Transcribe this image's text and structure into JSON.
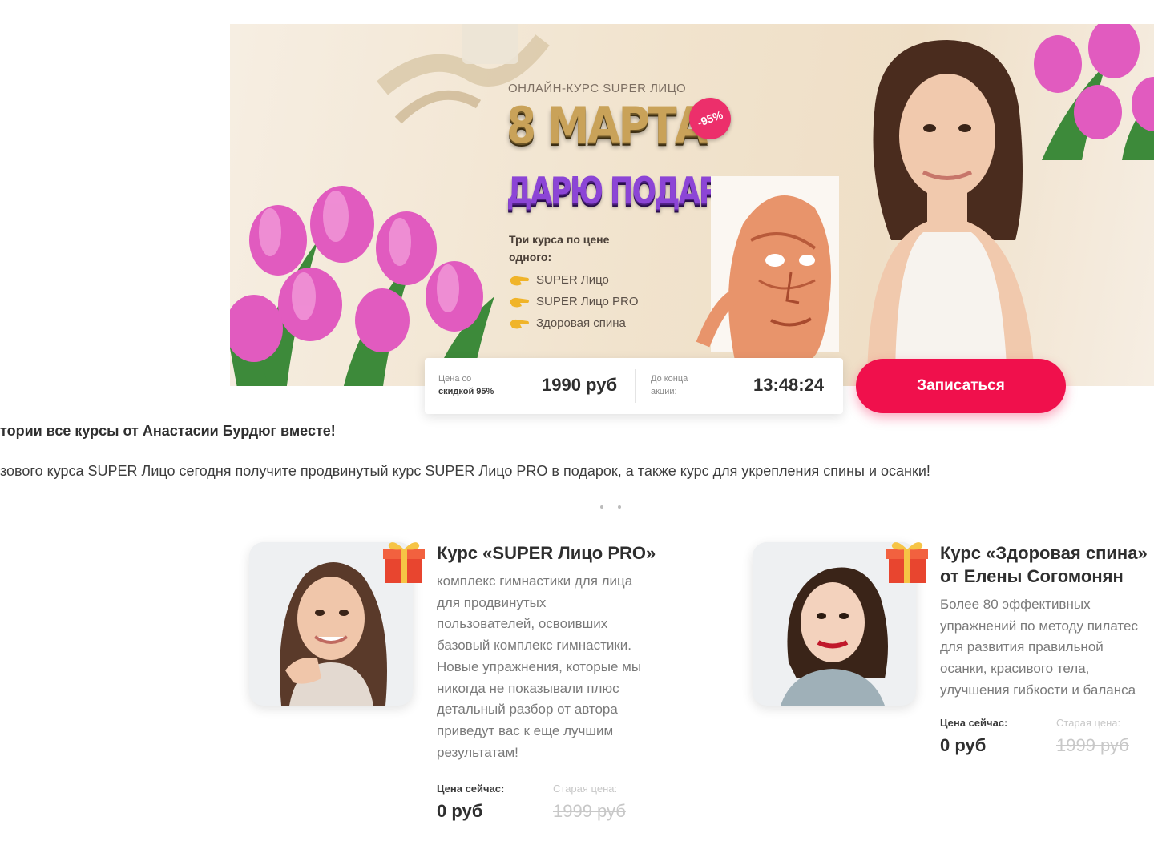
{
  "banner": {
    "subtitle": "ОНЛАЙН-КУРС SUPER ЛИЦО",
    "title_line1": "8 МАРТА",
    "title_line2": "ДАРЮ ПОДАРКИ",
    "discount_badge": "-95%",
    "offer_heading": "Три курса по цене одного:",
    "offer_items": [
      "SUPER Лицо",
      "SUPER Лицо PRO",
      "Здоровая спина"
    ],
    "colors": {
      "gold": "#c9a259",
      "purple": "#8c45d6",
      "accent": "#f0104c"
    }
  },
  "price_bar": {
    "price_label_line1": "Цена со",
    "price_label_line2": "скидкой 95%",
    "price_value": "1990 руб",
    "timer_label_line1": "До конца",
    "timer_label_line2": "акции:",
    "timer_value": "13:48:24"
  },
  "cta": {
    "label": "Записаться"
  },
  "intro": {
    "heading": "тории все курсы от Анастасии Бурдюг вместе!",
    "text": "зового курса SUPER Лицо сегодня получите продвинутый курс SUPER Лицо PRO в подарок, а также курс для укрепления спины и осанки!"
  },
  "courses": [
    {
      "title": "Курс «SUPER Лицо PRO»",
      "description": [
        "комплекс гимнастики для лица",
        "для продвинутых",
        "пользователей, освоивших",
        "базовый комплекс гимнастики.",
        "Новые упражнения, которые мы",
        "никогда не показывали плюс",
        "детальный разбор от автора",
        "приведут вас к еще лучшим",
        "результатам!"
      ],
      "price_now_label": "Цена сейчас:",
      "price_now": "0 руб",
      "price_old_label": "Старая цена:",
      "price_old": "1999 руб"
    },
    {
      "title_line1": "Курс «Здоровая спина»",
      "title_line2": "от Елены Согомонян",
      "description": [
        "Более 80 эффективных",
        "упражнений по методу пилатес",
        "для развития правильной",
        "осанки, красивого тела,",
        "улучшения гибкости и баланса"
      ],
      "price_now_label": "Цена сейчас:",
      "price_now": "0 руб",
      "price_old_label": "Старая цена:",
      "price_old": "1999 руб"
    }
  ]
}
